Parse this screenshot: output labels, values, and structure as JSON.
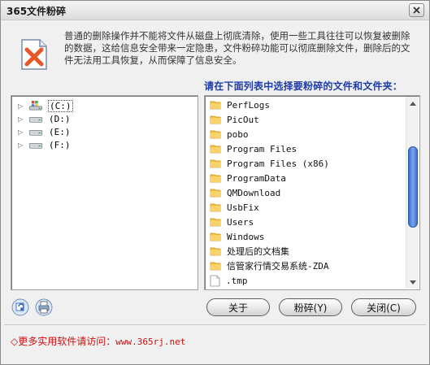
{
  "window": {
    "title": "365文件粉碎"
  },
  "icons": {
    "app": "shred-file-icon",
    "close": "close-icon",
    "folder": "folder-icon",
    "file": "file-icon",
    "drive": "hard-drive-icon",
    "system_drive": "system-drive-icon",
    "refresh": "refresh-icon",
    "printer": "printer-icon"
  },
  "description": "普通的删除操作并不能将文件从磁盘上彻底清除，使用一些工具往往可以恢复被删除的数据，这给信息安全带来一定隐患，文件粉碎功能可以彻底删除文件，删除后的文件无法用工具恢复，从而保障了信息安全。",
  "select_label": "请在下面列表中选择要粉碎的文件和文件夹：",
  "drives": [
    {
      "label": "(C:)",
      "selected": true
    },
    {
      "label": "(D:)",
      "selected": false
    },
    {
      "label": "(E:)",
      "selected": false
    },
    {
      "label": "(F:)",
      "selected": false
    }
  ],
  "files": [
    {
      "name": "PerfLogs",
      "type": "folder"
    },
    {
      "name": "PicOut",
      "type": "folder"
    },
    {
      "name": "pobo",
      "type": "folder"
    },
    {
      "name": "Program Files",
      "type": "folder"
    },
    {
      "name": "Program Files (x86)",
      "type": "folder"
    },
    {
      "name": "ProgramData",
      "type": "folder"
    },
    {
      "name": "QMDownload",
      "type": "folder"
    },
    {
      "name": "UsbFix",
      "type": "folder"
    },
    {
      "name": "Users",
      "type": "folder"
    },
    {
      "name": "Windows",
      "type": "folder"
    },
    {
      "name": "处理后的文档集",
      "type": "folder"
    },
    {
      "name": "信管家行情交易系统-ZDA",
      "type": "folder"
    },
    {
      "name": ".tmp",
      "type": "file"
    }
  ],
  "buttons": {
    "about": "关于",
    "shred": "粉碎(Y)",
    "close": "关闭(C)"
  },
  "footer": {
    "prefix": "◇更多实用软件请访问：",
    "url": "www.365rj.net"
  },
  "colors": {
    "accent": "#1e3caa",
    "footer_text": "#cc1010",
    "scroll_thumb": "#3b6fd0"
  }
}
